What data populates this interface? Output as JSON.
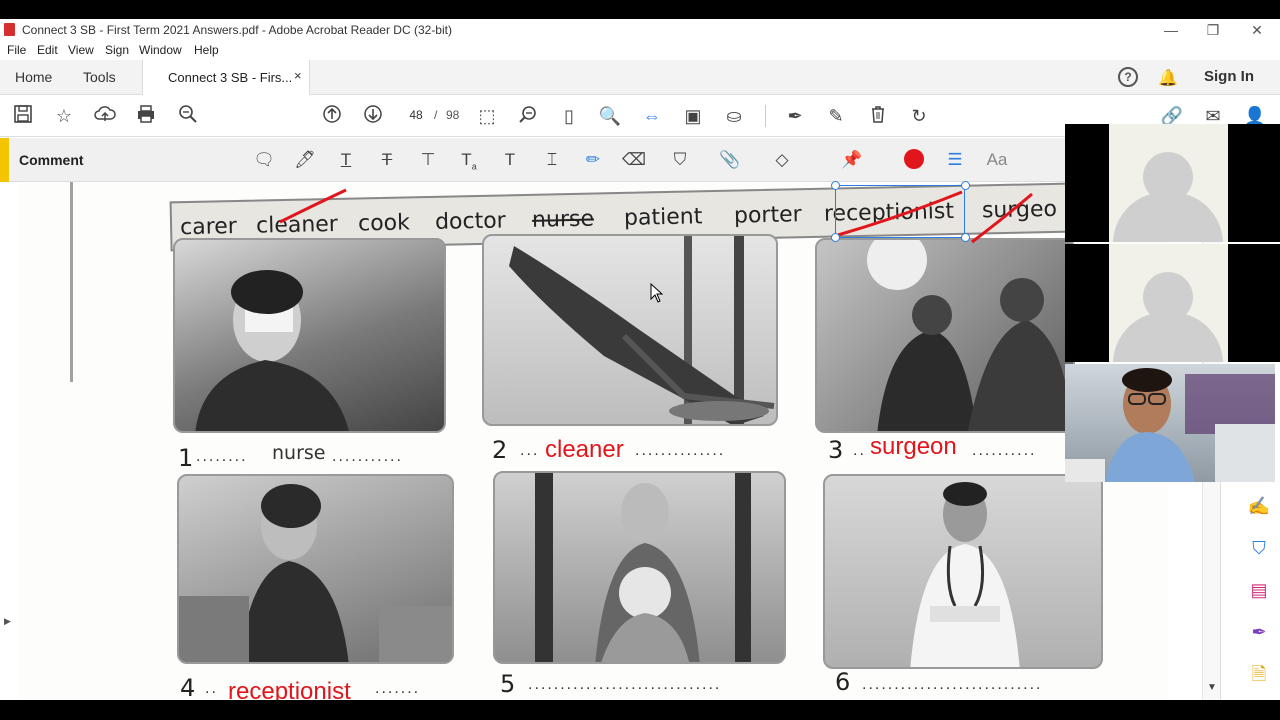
{
  "window": {
    "title": "Connect 3 SB - First Term 2021 Answers.pdf - Adobe Acrobat Reader DC (32-bit)",
    "minimize": "—",
    "restore": "❐",
    "close": "✕"
  },
  "menu": [
    "File",
    "Edit",
    "View",
    "Sign",
    "Window",
    "Help"
  ],
  "tabs": {
    "home": "Home",
    "tools": "Tools",
    "doc": "Connect 3 SB - Firs...",
    "close": "×",
    "signin": "Sign In",
    "help": "?"
  },
  "toolbar": {
    "page_current": "48",
    "page_sep": "/",
    "page_total": "98"
  },
  "comment": {
    "label": "Comment",
    "font_label": "Aa",
    "active_color": "#e0161c"
  },
  "worksheet": {
    "word_bank": [
      "carer",
      "cleaner",
      "cook",
      "doctor",
      "nurse",
      "patient",
      "porter",
      "receptionist",
      "surgeo"
    ],
    "items": [
      {
        "num": "1",
        "dots_before": "........",
        "printed": "nurse",
        "dots_after": "...........",
        "answer": ""
      },
      {
        "num": "2",
        "dots_before": "...",
        "printed": "",
        "dots_after": "..............",
        "answer": "cleaner"
      },
      {
        "num": "3",
        "dots_before": "..",
        "printed": "",
        "dots_after": "..........",
        "answer": "surgeon"
      },
      {
        "num": "4",
        "dots_before": "..",
        "printed": "",
        "dots_after": ".......",
        "answer": "receptionist"
      },
      {
        "num": "5",
        "dots_before": "",
        "printed": "",
        "dots_after": "..............................",
        "answer": ""
      },
      {
        "num": "6",
        "dots_before": "",
        "printed": "",
        "dots_after": "............................",
        "answer": ""
      }
    ],
    "answer_color": "#e0161c"
  }
}
